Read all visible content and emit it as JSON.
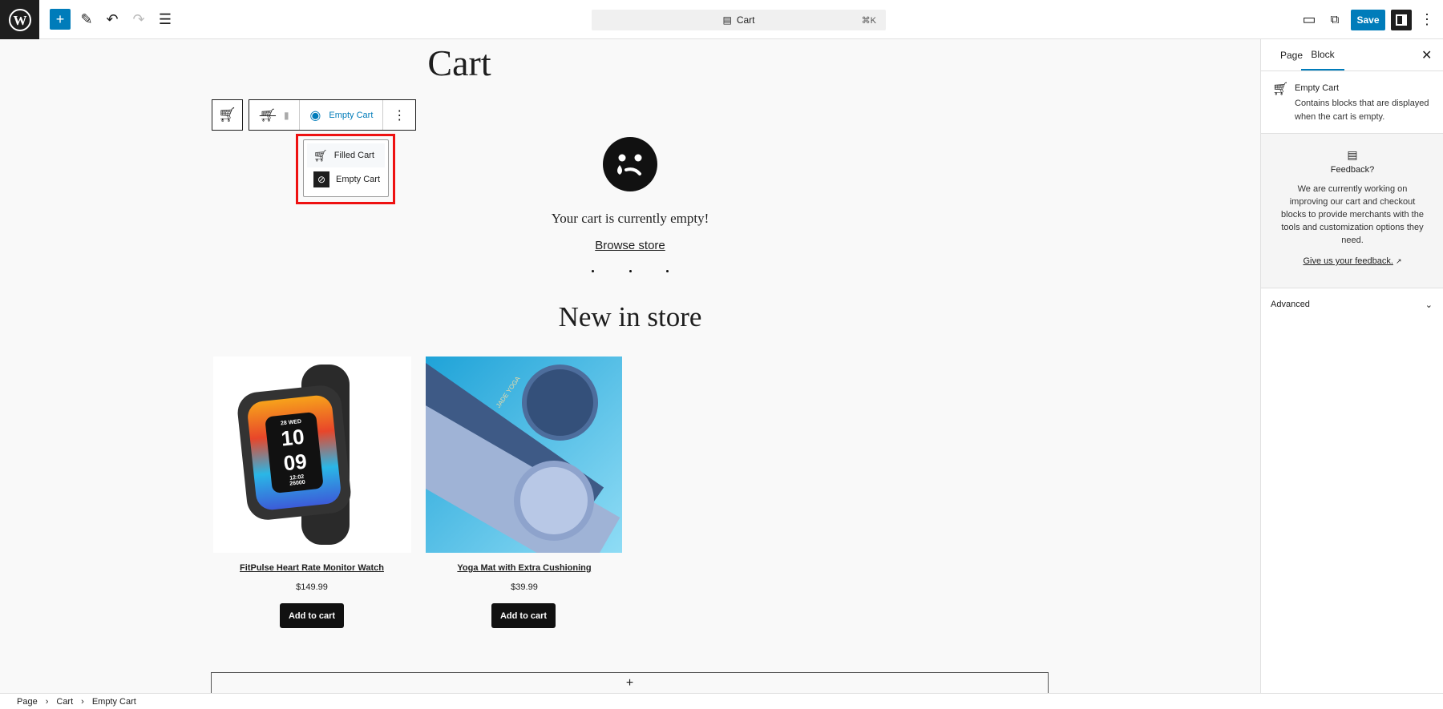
{
  "topbar": {
    "doc_title": "Cart",
    "shortcut": "⌘K",
    "save_label": "Save",
    "icons": [
      "wordpress-logo",
      "plus-icon",
      "pen-icon",
      "undo-icon",
      "redo-icon",
      "list-view-icon",
      "document-icon",
      "desktop-icon",
      "external-link-icon",
      "sidebar-icon",
      "kebab-icon"
    ]
  },
  "canvas": {
    "title": "Cart",
    "block_toolbar": {
      "view_label": "Empty Cart"
    },
    "view_menu": [
      {
        "label": "Filled Cart",
        "icon": "cart-icon"
      },
      {
        "label": "Empty Cart",
        "icon": "empty-cart-icon"
      }
    ],
    "empty_message": "Your cart is currently empty!",
    "browse_link": "Browse store",
    "section_title": "New in store",
    "products": [
      {
        "name": "FitPulse Heart Rate Monitor Watch",
        "price": "$149.99",
        "button": "Add to cart"
      },
      {
        "name": "Yoga Mat with Extra Cushioning",
        "price": "$39.99",
        "button": "Add to cart"
      }
    ],
    "watch_screen": {
      "date": "28 WED",
      "hour": "10",
      "minute": "09",
      "time": "12:02",
      "steps": "26000"
    },
    "mat_brand": "JADE YOGA"
  },
  "breadcrumb": [
    "Page",
    "Cart",
    "Empty Cart"
  ],
  "sidebar": {
    "tabs": [
      {
        "label": "Page"
      },
      {
        "label": "Block",
        "active": true
      }
    ],
    "block": {
      "title": "Empty Cart",
      "description": "Contains blocks that are displayed when the cart is empty."
    },
    "feedback": {
      "title": "Feedback?",
      "text": "We are currently working on improving our cart and checkout blocks to provide merchants with the tools and customization options they need.",
      "link": "Give us your feedback."
    },
    "advanced": "Advanced"
  },
  "colors": {
    "accent": "#007cba",
    "highlight": "#e11111"
  }
}
